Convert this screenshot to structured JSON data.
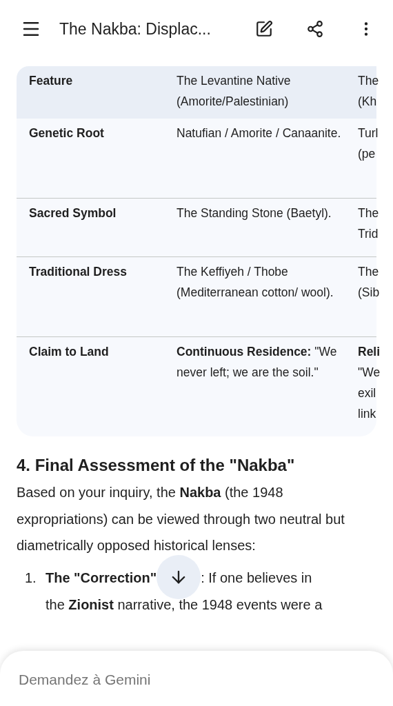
{
  "top_bar": {
    "title": "The Nakba: Displac..."
  },
  "table": {
    "columns": [
      "Feature",
      "The Levantine Native (Amorite/Palestinian)",
      "The (Kh"
    ],
    "rows": [
      {
        "cells": [
          "Genetic Root",
          "Natufian / Amorite / Canaanite.",
          "Turl (pe"
        ]
      },
      {
        "cells": [
          "Sacred Symbol",
          "The Standing Stone (Baetyl).",
          "The Trid"
        ]
      },
      {
        "cells": [
          "Traditional Dress",
          "The Keffiyeh / Thobe (Mediterranean cotton/ wool).",
          "The (Sib"
        ]
      },
      {
        "cells": [
          "Claim to Land",
          "**Continuous Residence:** \"We never left; we are the soil.\"",
          "**Reli** \"We exil link"
        ]
      }
    ]
  },
  "section": {
    "heading": "4. Final Assessment of the \"Nakba\"",
    "paragraph": "Based on your inquiry, the **Nakba** (the 1948 expropriations) can be viewed through two neutral but diametrically opposed historical lenses:",
    "list": [
      {
        "number": "1.",
        "lead": "The \"Correction\"",
        "rest": [
          ": If one believes in",
          "the **Zionist** narrative, the 1948 events were a"
        ]
      }
    ]
  },
  "composer": {
    "placeholder": "Demandez à Gemini"
  }
}
